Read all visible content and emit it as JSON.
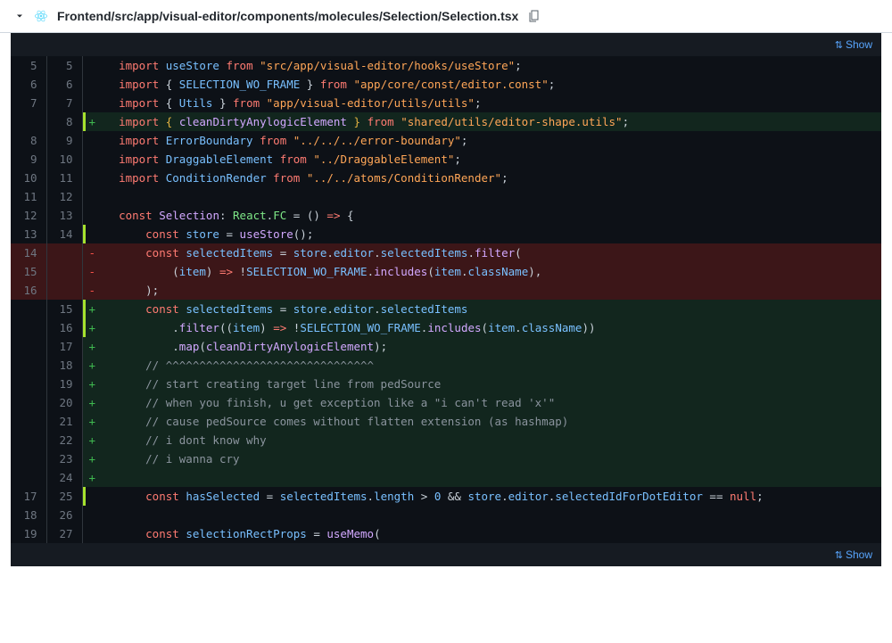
{
  "header": {
    "file_path": "Frontend/src/app/visual-editor/components/molecules/Selection/Selection.tsx"
  },
  "top_link": "Show",
  "bottom_link": "Show",
  "lines": [
    {
      "ln": "5",
      "rn": "5",
      "marker": " ",
      "type": "ctx",
      "html": "  <span class='kw'>import</span> <span class='id'>useStore</span> <span class='kw'>from</span> <span class='str2'>\"src/app/visual-editor/hooks/useStore\"</span>;"
    },
    {
      "ln": "6",
      "rn": "6",
      "marker": " ",
      "type": "ctx",
      "html": "  <span class='kw'>import</span> { <span class='id'>SELECTION_WO_FRAME</span> } <span class='kw'>from</span> <span class='str2'>\"app/core/const/editor.const\"</span>;"
    },
    {
      "ln": "7",
      "rn": "7",
      "marker": " ",
      "type": "ctx",
      "html": "  <span class='kw'>import</span> { <span class='id'>Utils</span> } <span class='kw'>from</span> <span class='str2'>\"app/visual-editor/utils/utils\"</span>;"
    },
    {
      "ln": "",
      "rn": "8",
      "marker": "+",
      "type": "add",
      "bar": true,
      "html": "  <span class='kw'>import</span> <span class='yl'>{</span> <span class='fn'>cleanDirtyAnylogicElement</span> <span class='yl'>}</span> <span class='kw'>from</span> <span class='str2'>\"shared/utils/editor-shape.utils\"</span>;"
    },
    {
      "ln": "8",
      "rn": "9",
      "marker": " ",
      "type": "ctx",
      "html": "  <span class='kw'>import</span> <span class='id'>ErrorBoundary</span> <span class='kw'>from</span> <span class='str2'>\"../../../error-boundary\"</span>;"
    },
    {
      "ln": "9",
      "rn": "10",
      "marker": " ",
      "type": "ctx",
      "html": "  <span class='kw'>import</span> <span class='id'>DraggableElement</span> <span class='kw'>from</span> <span class='str2'>\"../DraggableElement\"</span>;"
    },
    {
      "ln": "10",
      "rn": "11",
      "marker": " ",
      "type": "ctx",
      "html": "  <span class='kw'>import</span> <span class='id'>ConditionRender</span> <span class='kw'>from</span> <span class='str2'>\"../../atoms/ConditionRender\"</span>;"
    },
    {
      "ln": "11",
      "rn": "12",
      "marker": " ",
      "type": "ctx",
      "html": ""
    },
    {
      "ln": "12",
      "rn": "13",
      "marker": " ",
      "type": "ctx",
      "html": "  <span class='kw'>const</span> <span class='fn'>Selection</span>: <span class='type'>React</span>.<span class='type'>FC</span> = () <span class='kw'>=&gt;</span> {"
    },
    {
      "ln": "13",
      "rn": "14",
      "marker": " ",
      "type": "ctx",
      "bar": true,
      "html": "      <span class='kw'>const</span> <span class='id'>store</span> = <span class='fn'>useStore</span>();"
    },
    {
      "ln": "14",
      "rn": "",
      "marker": "-",
      "type": "del",
      "html": "      <span class='kw'>const</span> <span class='id'>selectedItems</span> = <span class='id'>store</span>.<span class='prop'>editor</span>.<span class='prop'>selectedItems</span>.<span class='fn'>filter</span>("
    },
    {
      "ln": "15",
      "rn": "",
      "marker": "-",
      "type": "del",
      "html": "          (<span class='id'>item</span>) <span class='kw'>=&gt;</span> !<span class='id'>SELECTION_WO_FRAME</span>.<span class='fn'>includes</span>(<span class='id'>item</span>.<span class='prop'>className</span>),"
    },
    {
      "ln": "16",
      "rn": "",
      "marker": "-",
      "type": "del",
      "html": "      );"
    },
    {
      "ln": "",
      "rn": "15",
      "marker": "+",
      "type": "add",
      "bar": true,
      "html": "      <span class='kw'>const</span> <span class='id'>selectedItems</span> = <span class='id'>store</span>.<span class='prop'>editor</span>.<span class='prop'>selectedItems</span>"
    },
    {
      "ln": "",
      "rn": "16",
      "marker": "+",
      "type": "add",
      "bar": true,
      "html": "          .<span class='fn'>filter</span>((<span class='id'>item</span>) <span class='kw'>=&gt;</span> !<span class='id'>SELECTION_WO_FRAME</span>.<span class='fn'>includes</span>(<span class='id'>item</span>.<span class='prop'>className</span>))"
    },
    {
      "ln": "",
      "rn": "17",
      "marker": "+",
      "type": "add",
      "html": "          .<span class='fn'>map</span>(<span class='fn'>cleanDirtyAnylogicElement</span>);"
    },
    {
      "ln": "",
      "rn": "18",
      "marker": "+",
      "type": "add",
      "html": "      <span class='cm'>// ^^^^^^^^^^^^^^^^^^^^^^^^^^^^^^^</span>"
    },
    {
      "ln": "",
      "rn": "19",
      "marker": "+",
      "type": "add",
      "html": "      <span class='cm'>// start creating target line from pedSource</span>"
    },
    {
      "ln": "",
      "rn": "20",
      "marker": "+",
      "type": "add",
      "html": "      <span class='cm'>// when you finish, u get exception like a \"i can't read 'x'\"</span>"
    },
    {
      "ln": "",
      "rn": "21",
      "marker": "+",
      "type": "add",
      "html": "      <span class='cm'>// cause pedSource comes without flatten extension (as hashmap)</span>"
    },
    {
      "ln": "",
      "rn": "22",
      "marker": "+",
      "type": "add",
      "html": "      <span class='cm'>// i dont know why</span>"
    },
    {
      "ln": "",
      "rn": "23",
      "marker": "+",
      "type": "add",
      "html": "      <span class='cm'>// i wanna cry</span>"
    },
    {
      "ln": "",
      "rn": "24",
      "marker": "+",
      "type": "add",
      "html": ""
    },
    {
      "ln": "17",
      "rn": "25",
      "marker": " ",
      "type": "ctx",
      "bar": true,
      "html": "      <span class='kw'>const</span> <span class='id'>hasSelected</span> = <span class='id'>selectedItems</span>.<span class='prop'>length</span> &gt; <span class='num'>0</span> &amp;&amp; <span class='id'>store</span>.<span class='prop'>editor</span>.<span class='prop'>selectedIdForDotEditor</span> == <span class='kw'>null</span>;"
    },
    {
      "ln": "18",
      "rn": "26",
      "marker": " ",
      "type": "ctx",
      "html": ""
    },
    {
      "ln": "19",
      "rn": "27",
      "marker": " ",
      "type": "ctx",
      "html": "      <span class='kw'>const</span> <span class='id'>selectionRectProps</span> = <span class='fn'>useMemo</span>("
    }
  ]
}
